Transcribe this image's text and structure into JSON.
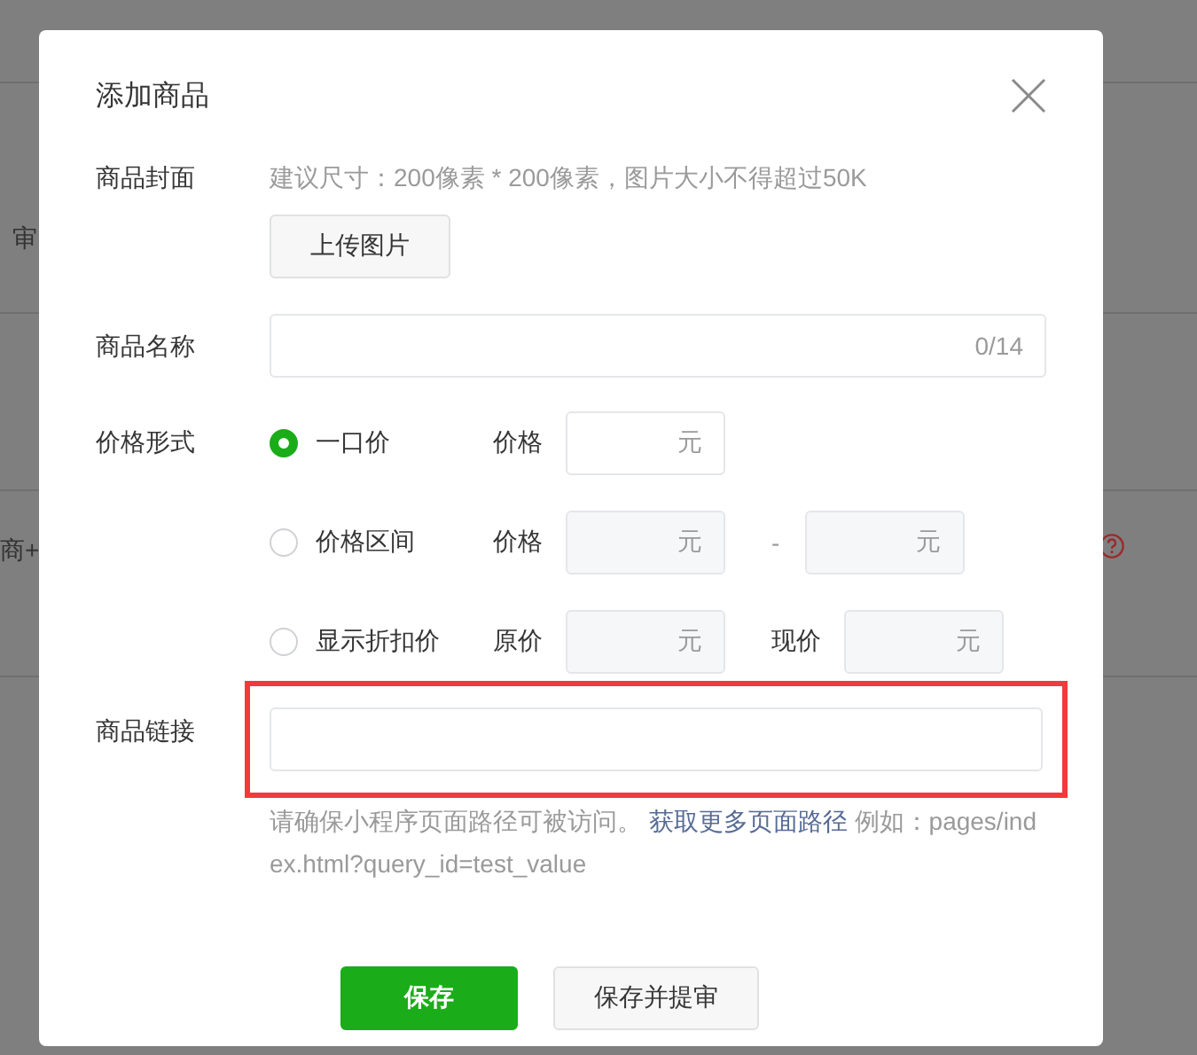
{
  "background": {
    "fragments": [
      {
        "text": "审",
        "kind": "text"
      },
      {
        "text": "商+",
        "kind": "text"
      }
    ]
  },
  "dialog": {
    "title": "添加商品",
    "cover": {
      "label": "商品封面",
      "hint": "建议尺寸：200像素 * 200像素，图片大小不得超过50K",
      "button": "上传图片"
    },
    "name": {
      "label": "商品名称",
      "counter": "0/14"
    },
    "price": {
      "label": "价格形式",
      "options": [
        {
          "label": "一口价",
          "selected": true,
          "fields": [
            {
              "caption": "价格",
              "unit": "元"
            }
          ]
        },
        {
          "label": "价格区间",
          "selected": false,
          "fields": [
            {
              "caption": "价格",
              "unit": "元"
            },
            {
              "caption": "-",
              "unit": "元"
            }
          ]
        },
        {
          "label": "显示折扣价",
          "selected": false,
          "fields": [
            {
              "caption": "原价",
              "unit": "元"
            },
            {
              "caption": "现价",
              "unit": "元"
            }
          ]
        }
      ]
    },
    "link": {
      "label": "商品链接",
      "highlighted": true,
      "hint_before": "请确保小程序页面路径可被访问。 ",
      "hint_link": "获取更多页面路径",
      "hint_after": " 例如：pages/index.html?query_id=test_value"
    },
    "buttons": [
      {
        "label": "保存",
        "kind": "primary"
      },
      {
        "label": "保存并提审",
        "kind": "secondary"
      }
    ]
  }
}
